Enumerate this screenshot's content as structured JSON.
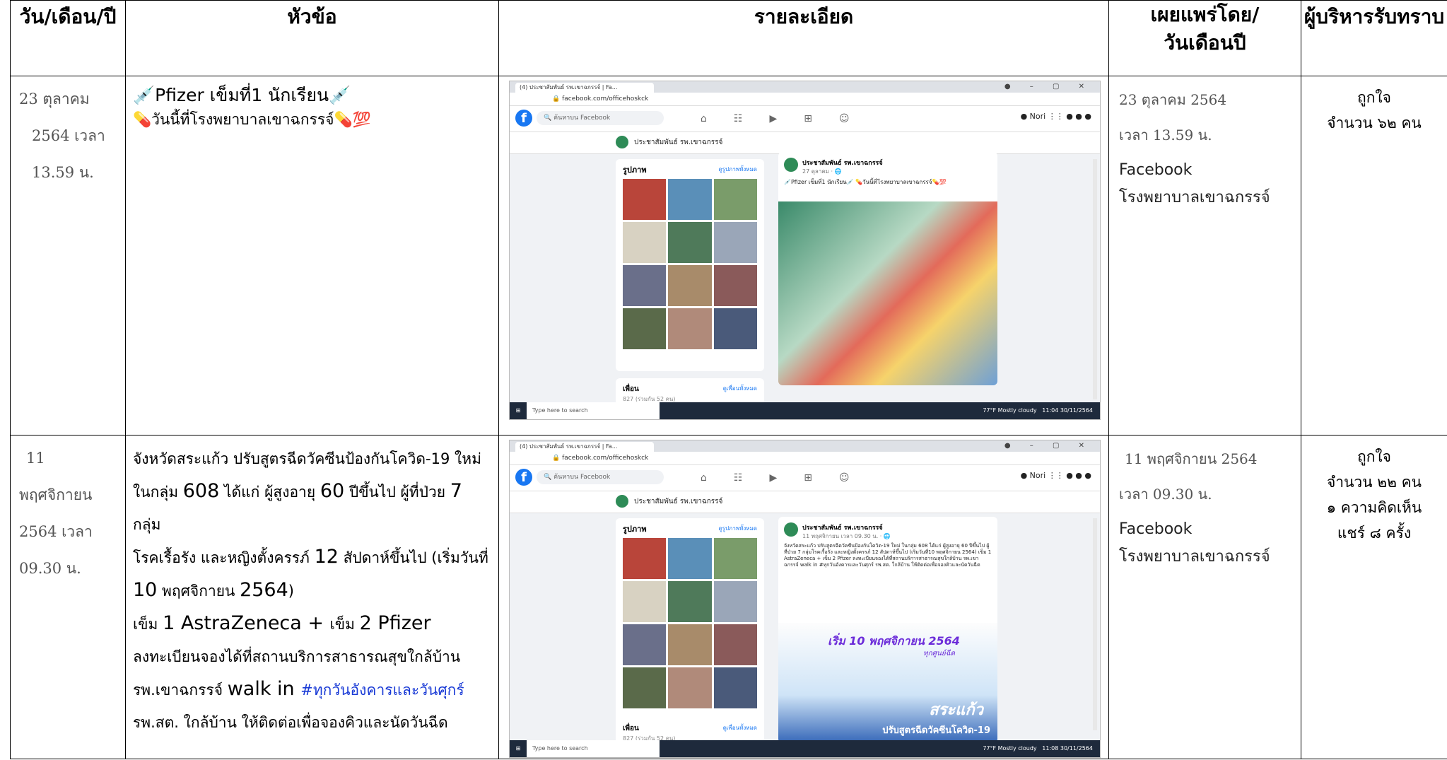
{
  "headers": [
    "วัน/เดือน/ปี",
    "หัวข้อ",
    "รายละเอียด",
    "เผยแพร่โดย/\nวันเดือนปี",
    "ผู้บริหารรับทราบ"
  ],
  "rows": [
    {
      "date_lines": [
        "23 ตุลาคม",
        "2564 เวลา",
        "13.59 น."
      ],
      "topic": {
        "line1": "💉Pfizer เข็มที่1 นักเรียน💉",
        "line2": "💊วันนี้ที่โรงพยาบาลเขาฉกรรจ์💊💯"
      },
      "screenshot": {
        "tab_title": "(4) ประชาสัมพันธ์ รพ.เขาฉกรรจ์ | Fa...",
        "url": "facebook.com/officehoskck",
        "search_placeholder": "ค้นหาบน Facebook",
        "user": "Nori",
        "page_name": "ประชาสัมพันธ์ รพ.เขาฉกรรจ์",
        "photos_heading": "รูปภาพ",
        "photos_link": "ดูรูปภาพทั้งหมด",
        "friends_heading": "เพื่อน",
        "friends_count": "827 (ร่วมกัน 52 คน)",
        "friends_link": "ดูเพื่อนทั้งหมด",
        "post_author": "ประชาสัมพันธ์ รพ.เขาฉกรรจ์",
        "post_time": "27 ตุลาคม · 🌐",
        "post_text": "💉Pfizer เข็มที่1 นักเรียน💉 💊วันนี้ที่โรงพยาบาลเขาฉกรรจ์💊💯",
        "taskbar_search": "Type here to search",
        "weather": "77°F Mostly cloudy",
        "clock": "11:04 30/11/2564"
      },
      "published": {
        "date": "23 ตุลาคม 2564",
        "time": "เวลา 13.59 น.",
        "channel": "Facebook",
        "org": "โรงพยาบาลเขาฉกรรจ์"
      },
      "ack": [
        "ถูกใจ",
        "จำนวน ๖๒ คน"
      ]
    },
    {
      "date_lines": [
        "11",
        "พฤศจิกายน",
        "2564 เวลา",
        "09.30 น."
      ],
      "topic": {
        "p1a": "จังหวัดสระแก้ว ปรับสูตรฉีดวัคซีนป้องกันโควิด-19 ใหม่",
        "p1b_pre": "ในกลุ่ม ",
        "p1b_num": "608",
        "p1b_mid": " ได้แก่ ผู้สูงอายุ ",
        "p1b_num2": "60",
        "p1b_mid2": " ปีขึ้นไป ผู้ที่ป่วย ",
        "p1b_num3": "7",
        "p1b_post": " กลุ่ม",
        "p1c_pre": "โรคเรื้อรัง และหญิงตั้งครรภ์ ",
        "p1c_num": "12",
        "p1c_post": " สัปดาห์ขึ้นไป (เริ่มวันที่",
        "p1d_num": "10",
        "p1d_mid": " พฤศจิกายน ",
        "p1d_num2": "2564",
        "p1d_post": ")",
        "p2_pre": "เข็ม ",
        "p2_big": "1 AstraZeneca + ",
        "p2_mid": "เข็ม ",
        "p2_big2": "2 Pfizer",
        "p3": "ลงทะเบียนจองได้ที่สถานบริการสาธารณสุขใกล้บ้าน",
        "p4_pre": "รพ.เขาฉกรรจ์ ",
        "p4_big": "walk in ",
        "p4_tag": "#ทุกวันอังคารและวันศุกร์",
        "p5": "รพ.สต. ใกล้บ้าน ให้ติดต่อเพื่อจองคิวและนัดวันฉีด"
      },
      "screenshot": {
        "tab_title": "(4) ประชาสัมพันธ์ รพ.เขาฉกรรจ์ | Fa...",
        "url": "facebook.com/officehoskck",
        "search_placeholder": "ค้นหาบน Facebook",
        "user": "Nori",
        "page_name": "ประชาสัมพันธ์ รพ.เขาฉกรรจ์",
        "photos_heading": "รูปภาพ",
        "photos_link": "ดูรูปภาพทั้งหมด",
        "friends_heading": "เพื่อน",
        "friends_count": "827 (ร่วมกัน 52 คน)",
        "friends_link": "ดูเพื่อนทั้งหมด",
        "post_author": "ประชาสัมพันธ์ รพ.เขาฉกรรจ์",
        "post_time": "11 พฤศจิกายน เวลา 09.30 น. · 🌐",
        "post_text": "จังหวัดสระแก้ว ปรับสูตรฉีดวัคซีนป้องกันโควิด-19 ใหม่ ในกลุ่ม 608 ได้แก่ ผู้สูงอายุ 60 ปีขึ้นไป ผู้ที่ป่วย 7 กลุ่มโรคเรื้อรัง และหญิงตั้งครรภ์ 12 สัปดาห์ขึ้นไป (เริ่มวันที่10 พฤศจิกายน 2564) เข็ม 1 AstraZeneca + เข็ม 2 Pfizer ลงทะเบียนจองได้ที่สถานบริการสาธารณสุขใกล้บ้าน รพ.เขาฉกรรจ์ walk in #ทุกวันอังคารและวันศุกร์ รพ.สต. ใกล้บ้าน ให้ติดต่อเพื่อจองคิวและนัดวันฉีด",
        "banner": "เริ่ม 10 พฤศจิกายน 2564",
        "banner_sub": "ทุกศูนย์ฉีด",
        "sakaeo": "สระแก้ว",
        "sakaeo_sub": "ปรับสูตรฉีดวัคซีนโควิด-19",
        "taskbar_search": "Type here to search",
        "weather": "77°F Mostly cloudy",
        "clock": "11:08 30/11/2564"
      },
      "published": {
        "date": "11 พฤศจิกายน 2564",
        "time": "เวลา 09.30 น.",
        "channel": "Facebook",
        "org": "โรงพยาบาลเขาฉกรรจ์"
      },
      "ack": [
        "ถูกใจ",
        "จำนวน ๒๒ คน",
        "๑ ความคิดเห็น",
        "แชร์ ๘ ครั้ง"
      ]
    }
  ],
  "colors": {
    "facebook_blue": "#1877f2",
    "hashtag": "#1a3bd6",
    "date_gray": "#555555"
  }
}
